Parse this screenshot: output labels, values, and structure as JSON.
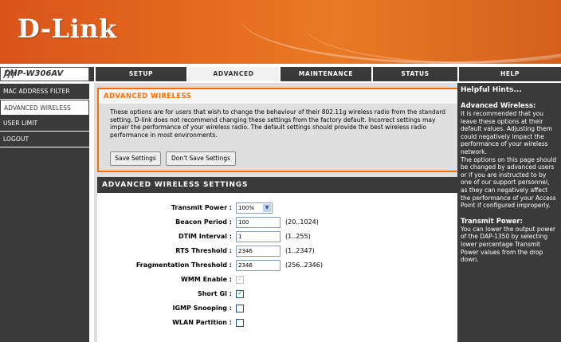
{
  "brand": {
    "logo": "D-Link"
  },
  "model": "DHP-W306AV",
  "tabs": [
    {
      "label": "SETUP",
      "active": false
    },
    {
      "label": "ADVANCED",
      "active": true
    },
    {
      "label": "MAINTENANCE",
      "active": false
    },
    {
      "label": "STATUS",
      "active": false
    },
    {
      "label": "HELP",
      "active": false
    }
  ],
  "sidebar": {
    "items": [
      {
        "label": "MAC ADDRESS FILTER",
        "active": false
      },
      {
        "label": "ADVANCED WIRELESS",
        "active": true
      },
      {
        "label": "USER LIMIT",
        "active": false
      },
      {
        "label": "LOGOUT",
        "active": false
      }
    ]
  },
  "advanced_wireless": {
    "title": "ADVANCED WIRELESS",
    "intro": "These options are for users that wish to change the behaviour of their 802.11g wireless radio from the standard setting. D-link does not recommend changing these settings from the factory default. Incorrect settings may impair the performance of your wireless radio. The default settings should provide the best wireless radio performance in most environments.",
    "save_label": "Save Settings",
    "dont_save_label": "Don't Save Settings"
  },
  "settings": {
    "title": "ADVANCED WIRELESS SETTINGS",
    "transmit_power": {
      "label": "Transmit Power :",
      "value": "100%"
    },
    "beacon_period": {
      "label": "Beacon Period :",
      "value": "100",
      "range": "(20..1024)"
    },
    "dtim_interval": {
      "label": "DTIM Interval :",
      "value": "1",
      "range": "(1..255)"
    },
    "rts_threshold": {
      "label": "RTS Threshold :",
      "value": "2346",
      "range": "(1..2347)"
    },
    "frag_threshold": {
      "label": "Fragmentation Threshold :",
      "value": "2346",
      "range": "(256..2346)"
    },
    "wmm_enable": {
      "label": "WMM Enable :",
      "checked": true,
      "disabled": true
    },
    "short_gi": {
      "label": "Short GI :",
      "checked": true
    },
    "igmp_snooping": {
      "label": "IGMP Snooping :",
      "checked": false
    },
    "wlan_partition": {
      "label": "WLAN Partition :",
      "checked": false
    }
  },
  "help": {
    "heading": "Helpful Hints...",
    "section1_title": "Advanced Wireless:",
    "section1_text": "It is recommended that you leave these options at their default values. Adjusting them could negatively impact the performance of your wireless network.",
    "section1_text2": "The options on this page should be changed by advanced users or if you are instructed to by one of our support personnel, as they can negatively affect the performance of your Access Point if configured improperly.",
    "section2_title": "Transmit Power:",
    "section2_text": "You can lower the output power of the DAP-1350 by selecting lower percentage Transmit Power values from the drop down."
  },
  "colors": {
    "accent": "#ff6f00",
    "nav": "#3a3a3a",
    "brand": "#e46a1e"
  }
}
